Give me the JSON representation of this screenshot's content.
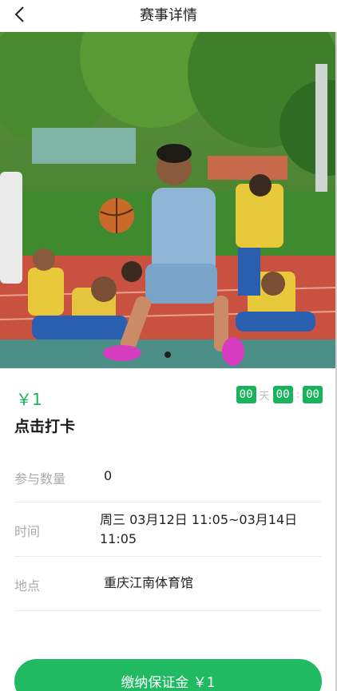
{
  "header": {
    "title": "赛事详情",
    "back_icon": "chevron-left-icon"
  },
  "banner": {
    "slide_count": 1,
    "active_slide": 1
  },
  "event": {
    "price": "￥1",
    "countdown": {
      "days": "00",
      "day_unit": "天",
      "hours": "00",
      "separator": ":",
      "minutes": "00"
    },
    "title": "点击打卡"
  },
  "info": {
    "participants_label": "参与数量",
    "participants_value": "0",
    "time_label": "时间",
    "time_value": "周三 03月12日 11:05~03月14日 11:05",
    "location_label": "地点",
    "location_value": "重庆江南体育馆"
  },
  "action": {
    "pay_label": "缴纳保证金 ￥1"
  },
  "colors": {
    "accent": "#19b35b",
    "button": "#1fba62",
    "label_gray": "#aaaaaa"
  }
}
